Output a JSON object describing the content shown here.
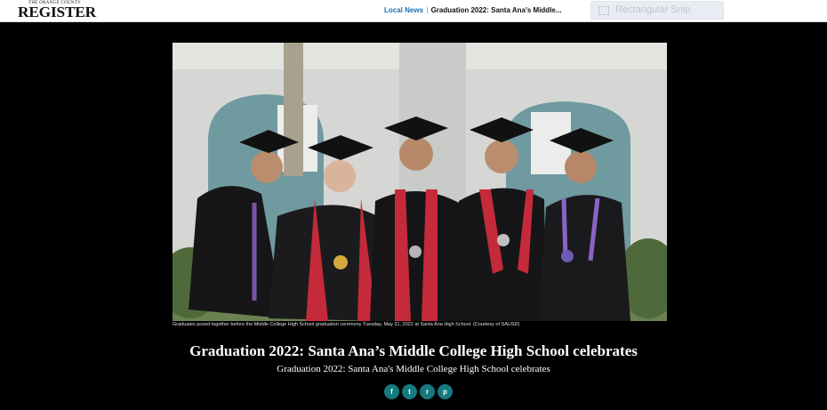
{
  "logo": {
    "small_text": "THE ORANGE COUNTY",
    "big_text": "REGISTER"
  },
  "breadcrumb": {
    "section": "Local News",
    "separator": "|",
    "current": "Graduation 2022: Santa Ana's Middle..."
  },
  "snip_tool": {
    "label": "Rectangular Snip",
    "icon": "rectangular-snip-icon"
  },
  "photo": {
    "caption": "Graduates posed together before the Middle College High School graduation ceremony Tuesday, May 31, 2022 at Santa Ana High School. (Courtesy of SAUSD)"
  },
  "article": {
    "headline": "Graduation 2022: Santa Ana’s Middle College High School celebrates",
    "subheadline": "Graduation 2022: Santa Ana's Middle College High School celebrates"
  },
  "share": [
    {
      "label": "f",
      "icon": "facebook-icon"
    },
    {
      "label": "t",
      "icon": "twitter-icon"
    },
    {
      "label": "r",
      "icon": "reddit-icon"
    },
    {
      "label": "p",
      "icon": "print-icon"
    }
  ],
  "colors": {
    "background": "#000000",
    "topbar": "#ffffff",
    "link": "#1a6fb5",
    "share_button": "#157a7f"
  }
}
